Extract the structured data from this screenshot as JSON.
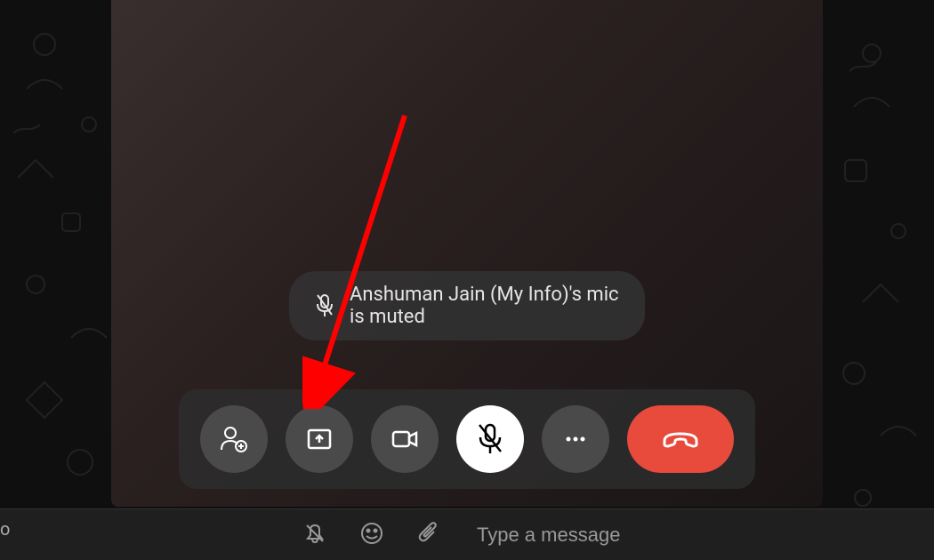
{
  "notification": {
    "text": "Anshuman Jain (My Info)'s mic is muted"
  },
  "controls": {
    "add_participant": "add-participant",
    "share_screen": "share-screen",
    "camera": "camera",
    "microphone": "microphone-muted",
    "more": "more-options",
    "end_call": "end-call"
  },
  "chat": {
    "placeholder": "Type a message",
    "partial_text": "o"
  },
  "colors": {
    "end_call": "#e84a3c",
    "arrow": "#ff0000"
  }
}
